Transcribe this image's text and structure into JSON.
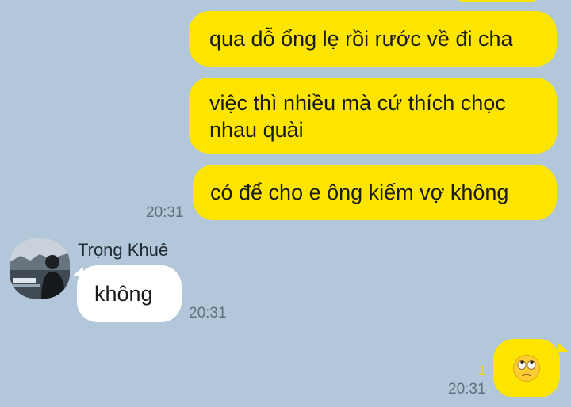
{
  "conversation": {
    "outgoing": [
      {
        "text": "qua dỗ ổng lẹ rồi rước về đi cha"
      },
      {
        "text": "việc thì nhiều mà cứ thích chọc nhau quài"
      },
      {
        "text": "có để cho e ông kiếm vợ không"
      }
    ],
    "outgoing_time": "20:31",
    "incoming": {
      "sender": "Trọng Khuê",
      "text": "không",
      "time": "20:31"
    },
    "last_outgoing": {
      "emoji": "face-with-rolling-eyes-emoji",
      "unread_count": "1",
      "time": "20:31"
    }
  },
  "colors": {
    "background": "#b2c7d9",
    "my_bubble": "#fee500",
    "their_bubble": "#ffffff",
    "timestamp": "#5f6f7d",
    "unread": "#f7d71a"
  }
}
